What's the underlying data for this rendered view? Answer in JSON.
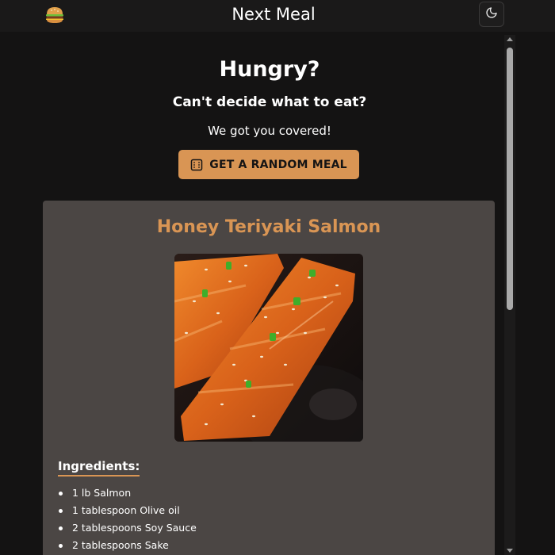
{
  "header": {
    "title": "Next Meal",
    "logo_icon": "burger-icon",
    "theme_toggle_icon": "moon-icon"
  },
  "hero": {
    "title": "Hungry?",
    "subtitle": "Can't decide what to eat?",
    "tagline": "We got you covered!",
    "button_label": "GET A RANDOM MEAL",
    "button_icon": "dice-icon"
  },
  "meal": {
    "name": "Honey Teriyaki Salmon",
    "image_icon": "salmon-photo",
    "ingredients_heading": "Ingredients:",
    "ingredients": [
      "1 lb Salmon",
      "1 tablespoon Olive oil",
      "2 tablespoons Soy Sauce",
      "2 tablespoons Sake"
    ]
  },
  "colors": {
    "accent": "#d99554",
    "background": "#141313",
    "card": "#4b4644",
    "text": "#ffffff"
  },
  "scrollbar": {
    "scroll_position": 0
  }
}
